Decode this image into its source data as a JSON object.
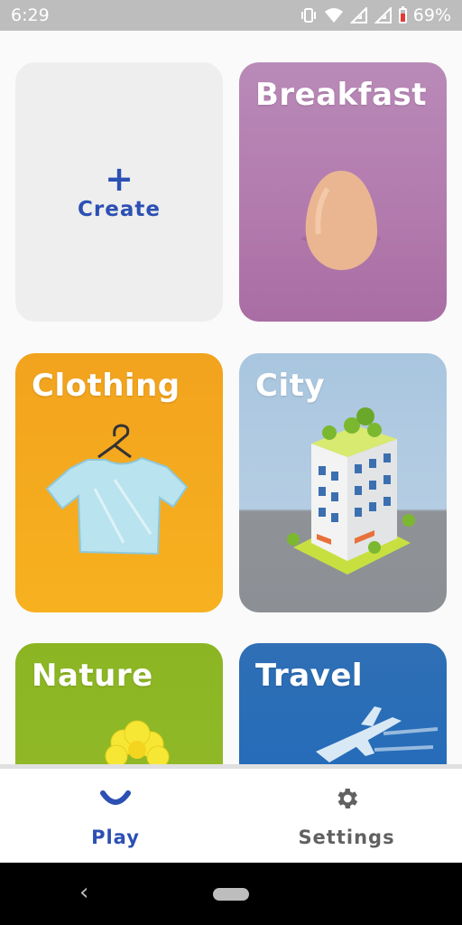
{
  "status": {
    "time": "6:29",
    "battery": "69%",
    "battery_color": "#e53935"
  },
  "cards": {
    "create": {
      "label": "Create",
      "icon": "plus-icon"
    },
    "breakfast": {
      "title": "Breakfast",
      "icon": "egg-icon",
      "color": "#b27aad"
    },
    "clothing": {
      "title": "Clothing",
      "icon": "shirt-icon",
      "color": "#f5aa1e"
    },
    "city": {
      "title": "City",
      "icon": "building-icon",
      "color": "#a9c6df"
    },
    "nature": {
      "title": "Nature",
      "icon": "flower-icon",
      "color": "#8bb523"
    },
    "travel": {
      "title": "Travel",
      "icon": "airplane-icon",
      "color": "#1a69bd"
    }
  },
  "bottom_nav": {
    "play": {
      "label": "Play",
      "icon": "smile-icon",
      "active": true,
      "color": "#2c50b3"
    },
    "settings": {
      "label": "Settings",
      "icon": "gear-icon",
      "active": false,
      "color": "#616161"
    }
  },
  "system_nav": {
    "back_icon": "back-icon",
    "home_icon": "home-pill-icon"
  }
}
